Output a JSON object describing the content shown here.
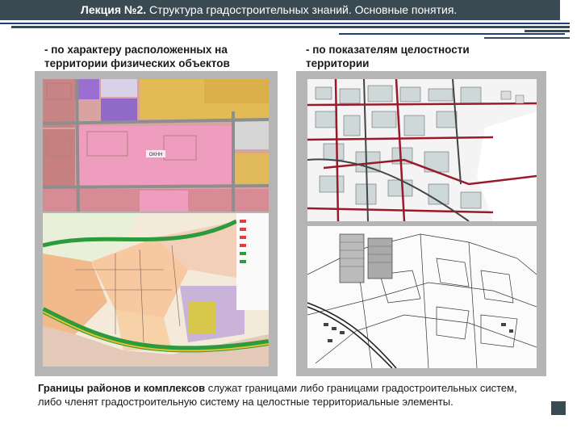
{
  "header": {
    "lecture_label": "Лекция №2.",
    "title": " Структура градостроительных знаний. Основные понятия."
  },
  "sections": {
    "left_heading": "- по характеру расположенных на территории физических объектов",
    "right_heading": "- по показателям целостности территории"
  },
  "maps": {
    "top_left_label": "ОКНН"
  },
  "footer": {
    "lead": "Границы районов и комплексов",
    "rest": " служат границами либо границами градостроительных систем, либо членят градостроительную систему на целостные территориальные элементы."
  },
  "colors": {
    "header_bg": "#3a4a52",
    "accent_blue": "#1f3d7a",
    "frame_gray": "#b5b5b5"
  }
}
